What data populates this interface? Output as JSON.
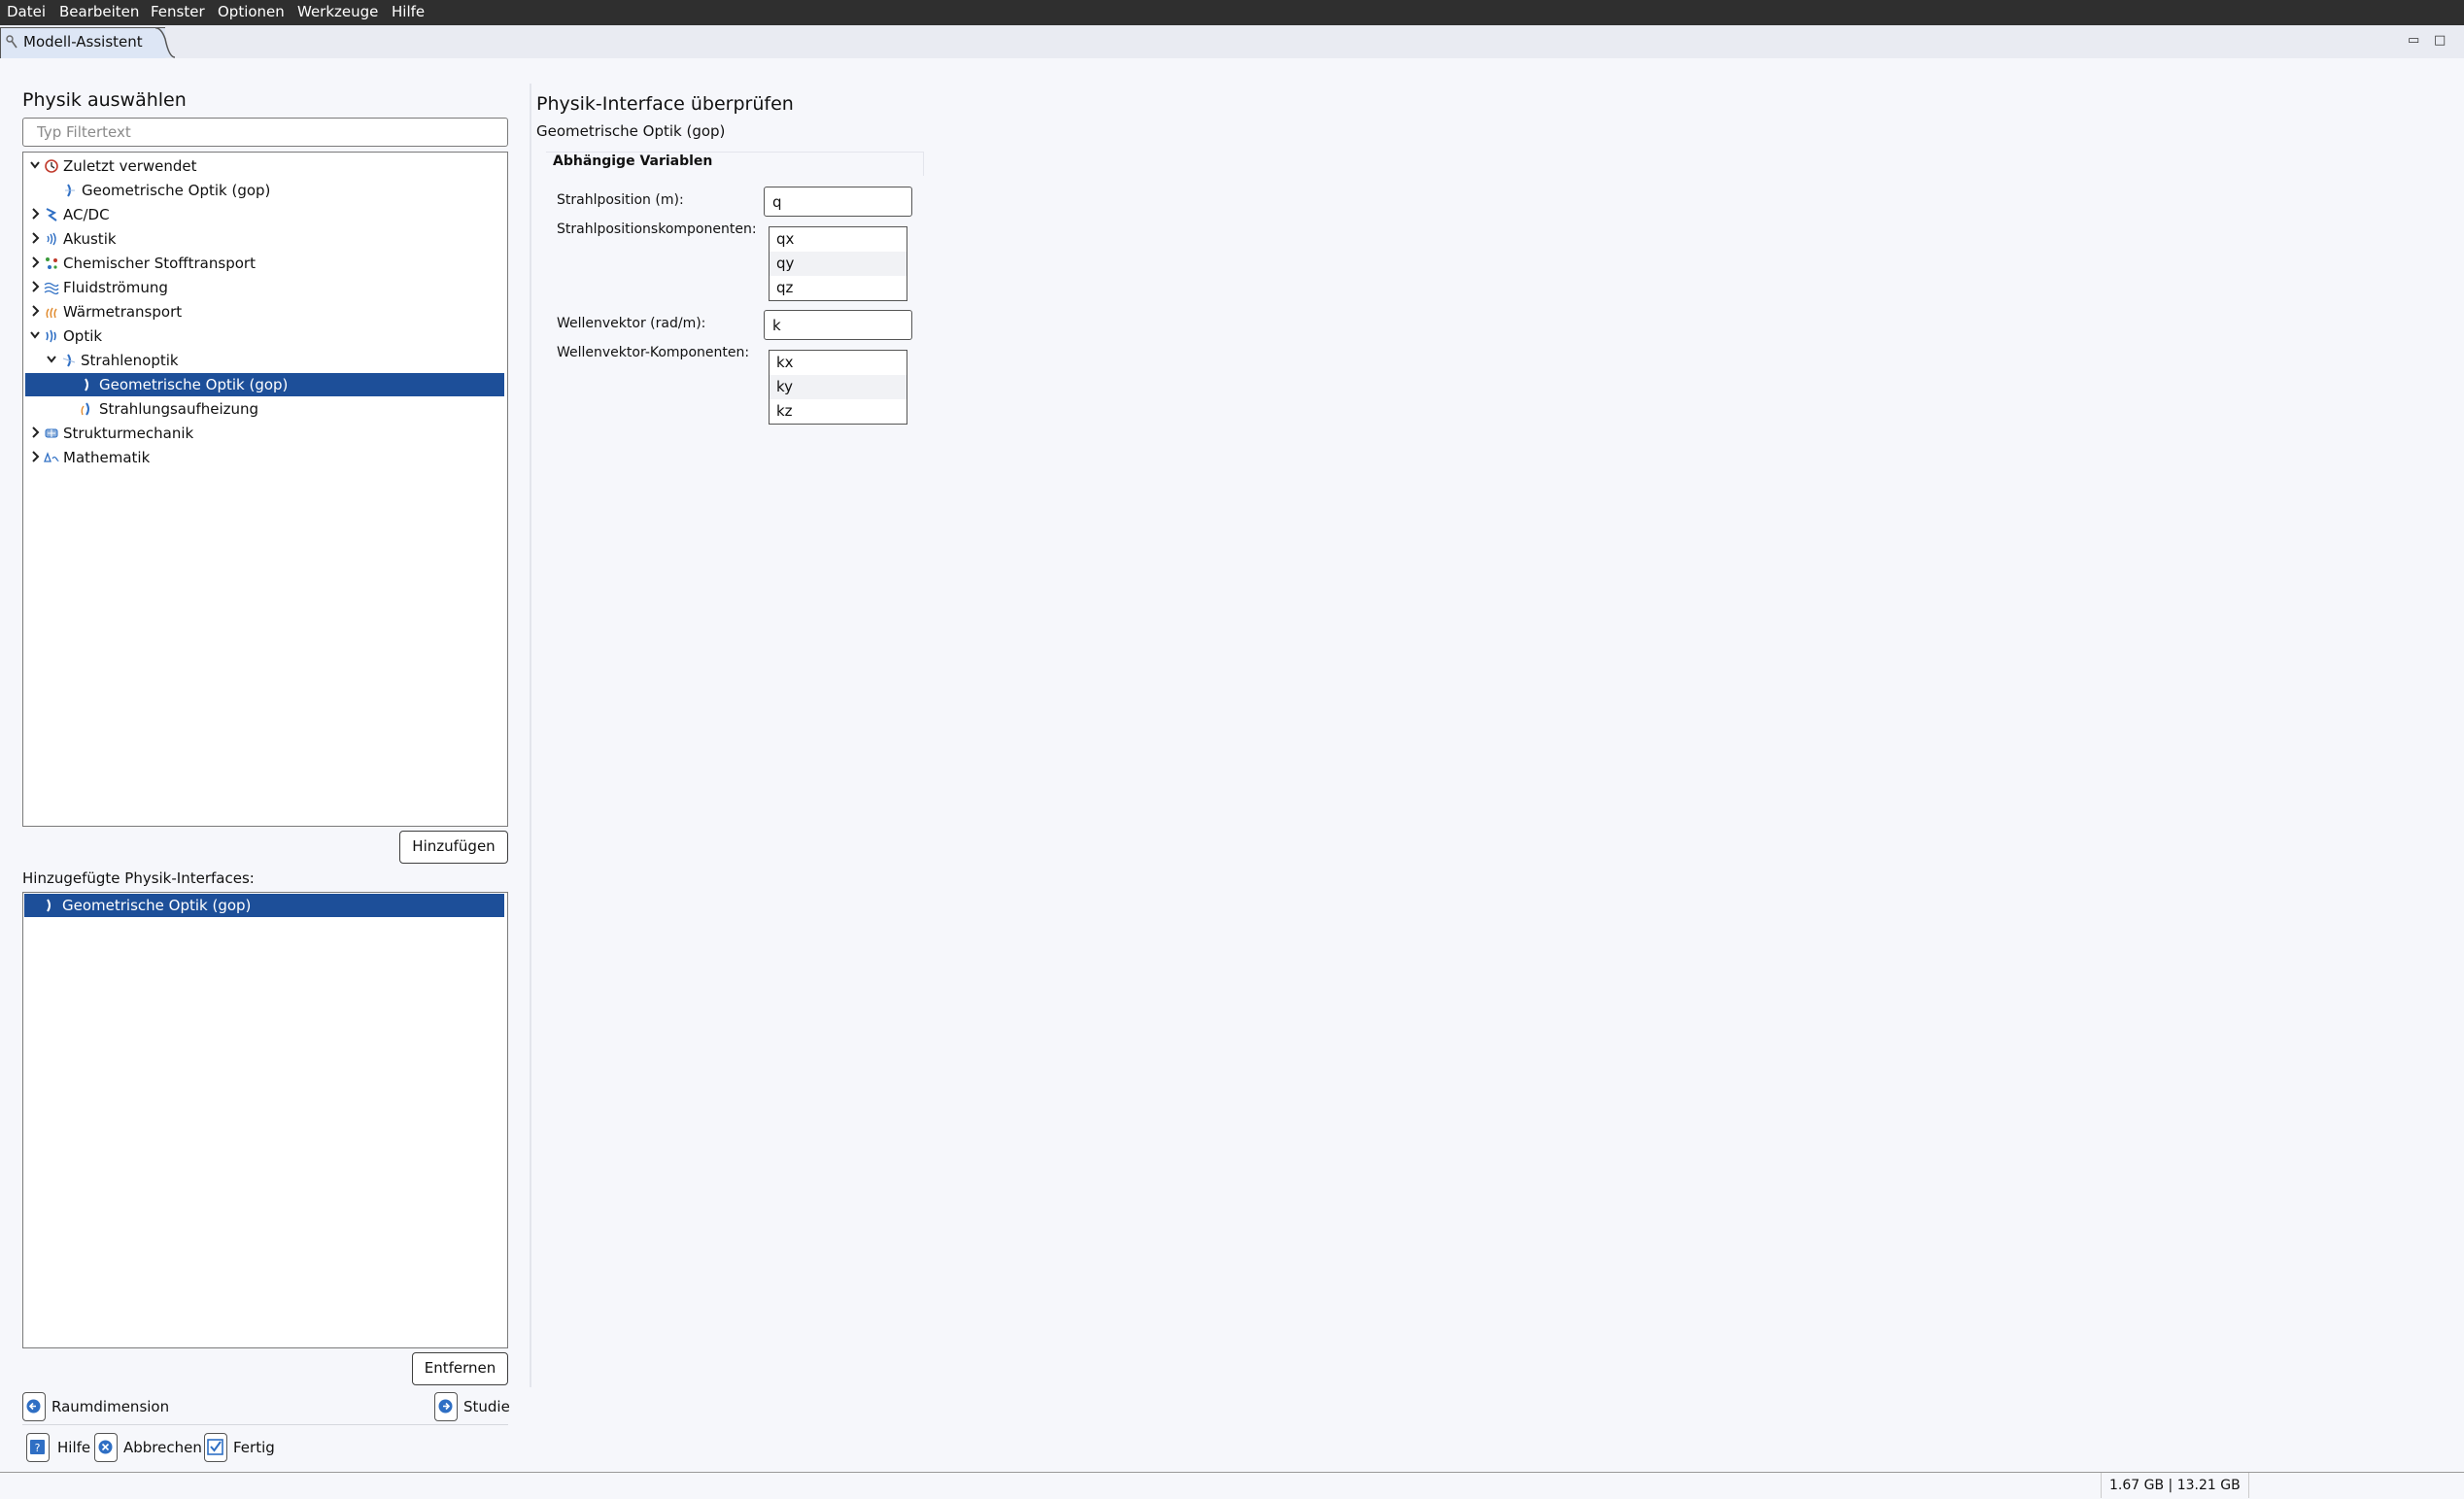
{
  "menu": [
    "Datei",
    "Bearbeiten",
    "Fenster",
    "Optionen",
    "Werkzeuge",
    "Hilfe"
  ],
  "tab": {
    "title": "Modell-Assistent"
  },
  "left": {
    "heading": "Physik auswählen",
    "filter_placeholder": "Typ Filtertext",
    "tree": [
      {
        "label": "Zuletzt verwendet",
        "icon": "clock-icon",
        "expanded": true
      },
      {
        "label": "Geometrische Optik (gop)",
        "icon": "ray-optics-icon"
      },
      {
        "label": "AC/DC",
        "icon": "acdc-icon",
        "expanded": false
      },
      {
        "label": "Akustik",
        "icon": "acoustics-icon",
        "expanded": false
      },
      {
        "label": "Chemischer Stofftransport",
        "icon": "chemical-transport-icon",
        "expanded": false
      },
      {
        "label": "Fluidströmung",
        "icon": "fluid-flow-icon",
        "expanded": false
      },
      {
        "label": "Wärmetransport",
        "icon": "heat-transfer-icon",
        "expanded": false
      },
      {
        "label": "Optik",
        "icon": "optics-icon",
        "expanded": true
      },
      {
        "label": "Strahlenoptik",
        "icon": "ray-optics-icon",
        "expanded": true
      },
      {
        "label": "Geometrische Optik (gop)",
        "icon": "ray-optics-icon",
        "selected": true
      },
      {
        "label": "Strahlungsaufheizung",
        "icon": "ray-heating-icon"
      },
      {
        "label": "Strukturmechanik",
        "icon": "structural-mechanics-icon",
        "expanded": false
      },
      {
        "label": "Mathematik",
        "icon": "mathematics-icon",
        "expanded": false
      }
    ],
    "add_button": "Hinzufügen",
    "added_label": "Hinzugefügte Physik-Interfaces:",
    "added_items": [
      "Geometrische Optik (gop)"
    ],
    "remove_button": "Entfernen",
    "nav_back": "Raumdimension",
    "nav_next": "Studie",
    "help": "Hilfe",
    "cancel": "Abbrechen",
    "done": "Fertig"
  },
  "right": {
    "heading": "Physik-Interface überprüfen",
    "subheading": "Geometrische Optik (gop)",
    "section": "Abhängige Variablen",
    "ray_position_label": "Strahlposition (m):",
    "ray_position_value": "q",
    "ray_position_components_label": "Strahlpositionskomponenten:",
    "ray_position_components": [
      "qx",
      "qy",
      "qz"
    ],
    "wave_vector_label": "Wellenvektor (rad/m):",
    "wave_vector_value": "k",
    "wave_vector_components_label": "Wellenvektor-Komponenten:",
    "wave_vector_components": [
      "kx",
      "ky",
      "kz"
    ]
  },
  "status": {
    "memory": "1.67 GB | 13.21 GB"
  },
  "colors": {
    "selection": "#1d4f99",
    "menubar": "#2f2f2f",
    "accent_icon": "#2f6fc4"
  }
}
